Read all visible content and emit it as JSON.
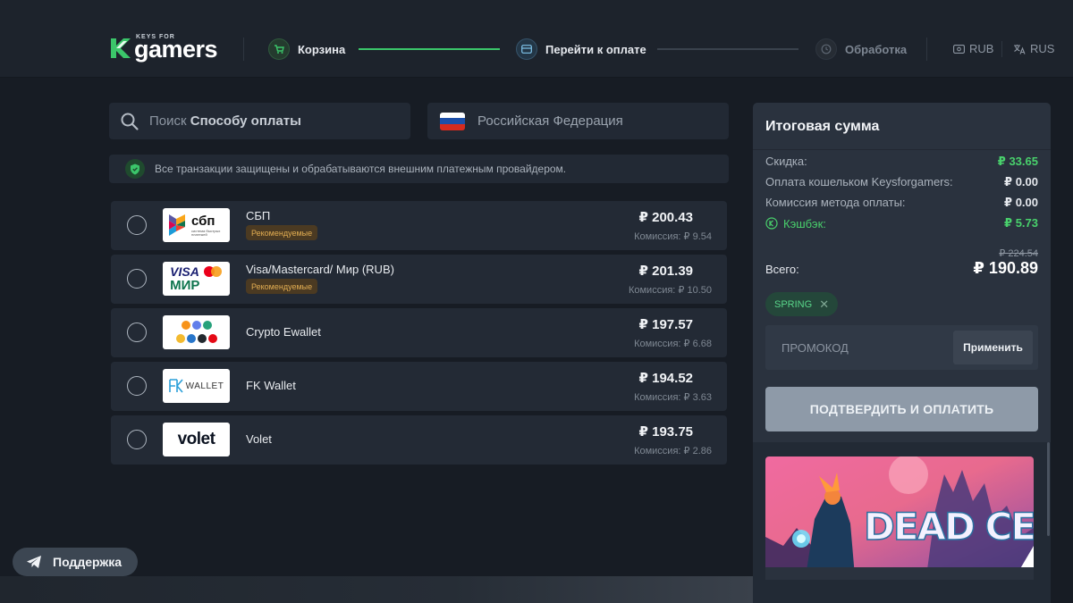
{
  "header": {
    "logo": {
      "small": "KEYS FOR",
      "big": "gamers"
    },
    "steps": [
      {
        "label": "Корзина",
        "state": "done",
        "icon": "cart-icon"
      },
      {
        "label": "Перейти к оплате",
        "state": "active",
        "icon": "card-icon"
      },
      {
        "label": "Обработка",
        "state": "pending",
        "icon": "clock-icon"
      }
    ],
    "currency": "RUB",
    "language": "RUS"
  },
  "search": {
    "prefix": "Поиск ",
    "bold": "Способу оплаты"
  },
  "country": {
    "name": "Российская Федерация",
    "flag_colors": [
      "#ffffff",
      "#1c4fa8",
      "#d52b1e"
    ]
  },
  "secure_notice": "Все транзакции защищены и обрабатываются внешним платежным провайдером.",
  "payment_methods": [
    {
      "name": "СБП",
      "badge": "Рекомендуемые",
      "price": "₽ 200.43",
      "fee": "Комиссия: ₽ 9.54",
      "logo": "sbp-logo",
      "logo_text": "сбп",
      "logo_subtext": "система быстрых платежей"
    },
    {
      "name": "Visa/Mastercard/ Мир (RUB)",
      "badge": "Рекомендуемые",
      "price": "₽ 201.39",
      "fee": "Комиссия: ₽ 10.50",
      "logo": "visa-mastercard-mir-logo",
      "logo_text": "VISA",
      "logo_subtext": "МИР"
    },
    {
      "name": "Crypto Ewallet",
      "badge": "",
      "price": "₽ 197.57",
      "fee": "Комиссия: ₽ 6.68",
      "logo": "crypto-logo"
    },
    {
      "name": "FK Wallet",
      "badge": "",
      "price": "₽ 194.52",
      "fee": "Комиссия: ₽ 3.63",
      "logo": "fk-wallet-logo",
      "logo_text": "WALLET"
    },
    {
      "name": "Volet",
      "badge": "",
      "price": "₽ 193.75",
      "fee": "Комиссия: ₽ 2.86",
      "logo": "volet-logo",
      "logo_text": "volet"
    }
  ],
  "summary": {
    "title": "Итоговая сумма",
    "rows": [
      {
        "label": "Скидка:",
        "value": "₽ 33.65",
        "accent": "green"
      },
      {
        "label": "Оплата кошельком Keysforgamers:",
        "value": "₽ 0.00",
        "accent": ""
      },
      {
        "label": "Комиссия метода оплаты:",
        "value": "₽ 0.00",
        "accent": ""
      },
      {
        "label": "Кэшбэк:",
        "value": "₽ 5.73",
        "accent": "green"
      }
    ],
    "old_total": "₽ 224.54",
    "total_label": "Всего:",
    "total": "₽ 190.89",
    "promo_tag": "SPRING",
    "promo_placeholder": "ПРОМОКОД",
    "apply_label": "Применить",
    "confirm_label": "ПОДТВЕРДИТЬ И ОПЛАТИТЬ",
    "game": {
      "title": "DEAD CELLS",
      "colors": [
        "#e0508a",
        "#f3a26a",
        "#2f9fc9"
      ]
    }
  },
  "support_label": "Поддержка",
  "colors": {
    "accent_green": "#49d16c",
    "badge_text": "#e2ad52",
    "background": "#171c24"
  }
}
